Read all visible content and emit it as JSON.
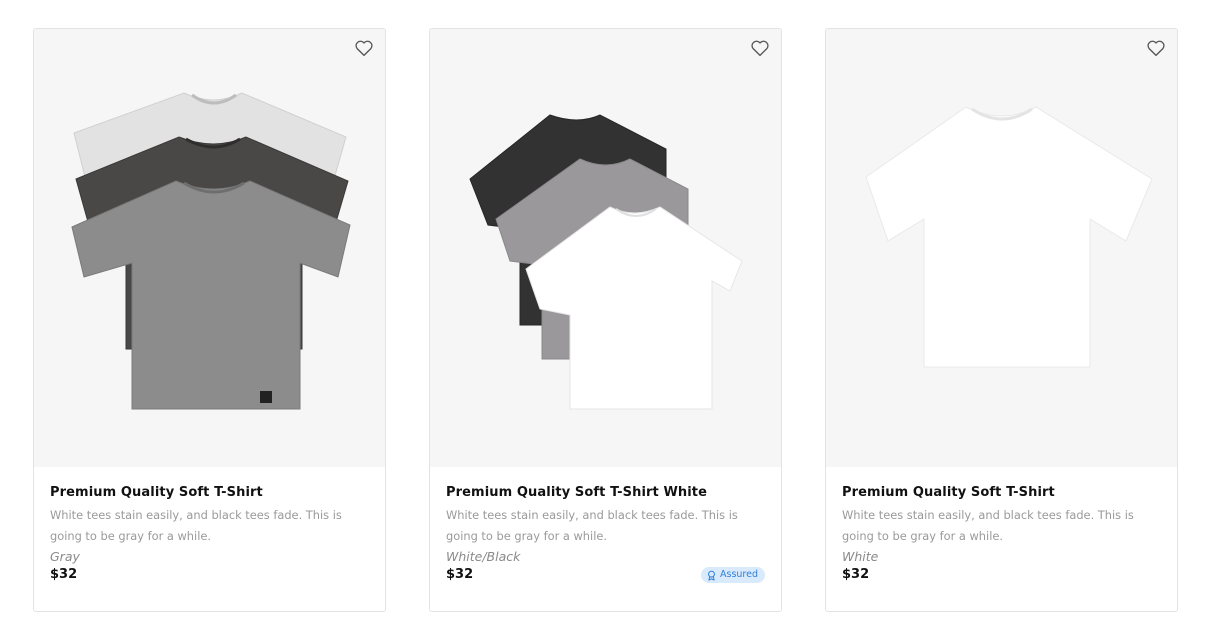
{
  "products": [
    {
      "title": "Premium Quality Soft T-Shirt",
      "description": "White tees stain easily, and black tees fade. This is going to be gray for a while.",
      "variant": "Gray",
      "price": "$32",
      "image_icon": "gray-tshirt-stack-image"
    },
    {
      "title": "Premium Quality Soft T-Shirt White",
      "description": "White tees stain easily, and black tees fade. This is going to be gray for a while.",
      "variant": "White/Black",
      "price": "$32",
      "badge": "Assured",
      "image_icon": "mixed-tshirt-stack-image"
    },
    {
      "title": "Premium Quality Soft T-Shirt",
      "description": "White tees stain easily, and black tees fade. This is going to be gray for a while.",
      "variant": "White",
      "price": "$32",
      "image_icon": "white-tshirt-image"
    }
  ],
  "icons": {
    "wishlist": "heart-outline-icon",
    "assured": "award-ribbon-icon"
  },
  "colors": {
    "badge_bg": "#d9eafc",
    "badge_text": "#2f7fd9",
    "muted_text": "#9a9a9a"
  }
}
